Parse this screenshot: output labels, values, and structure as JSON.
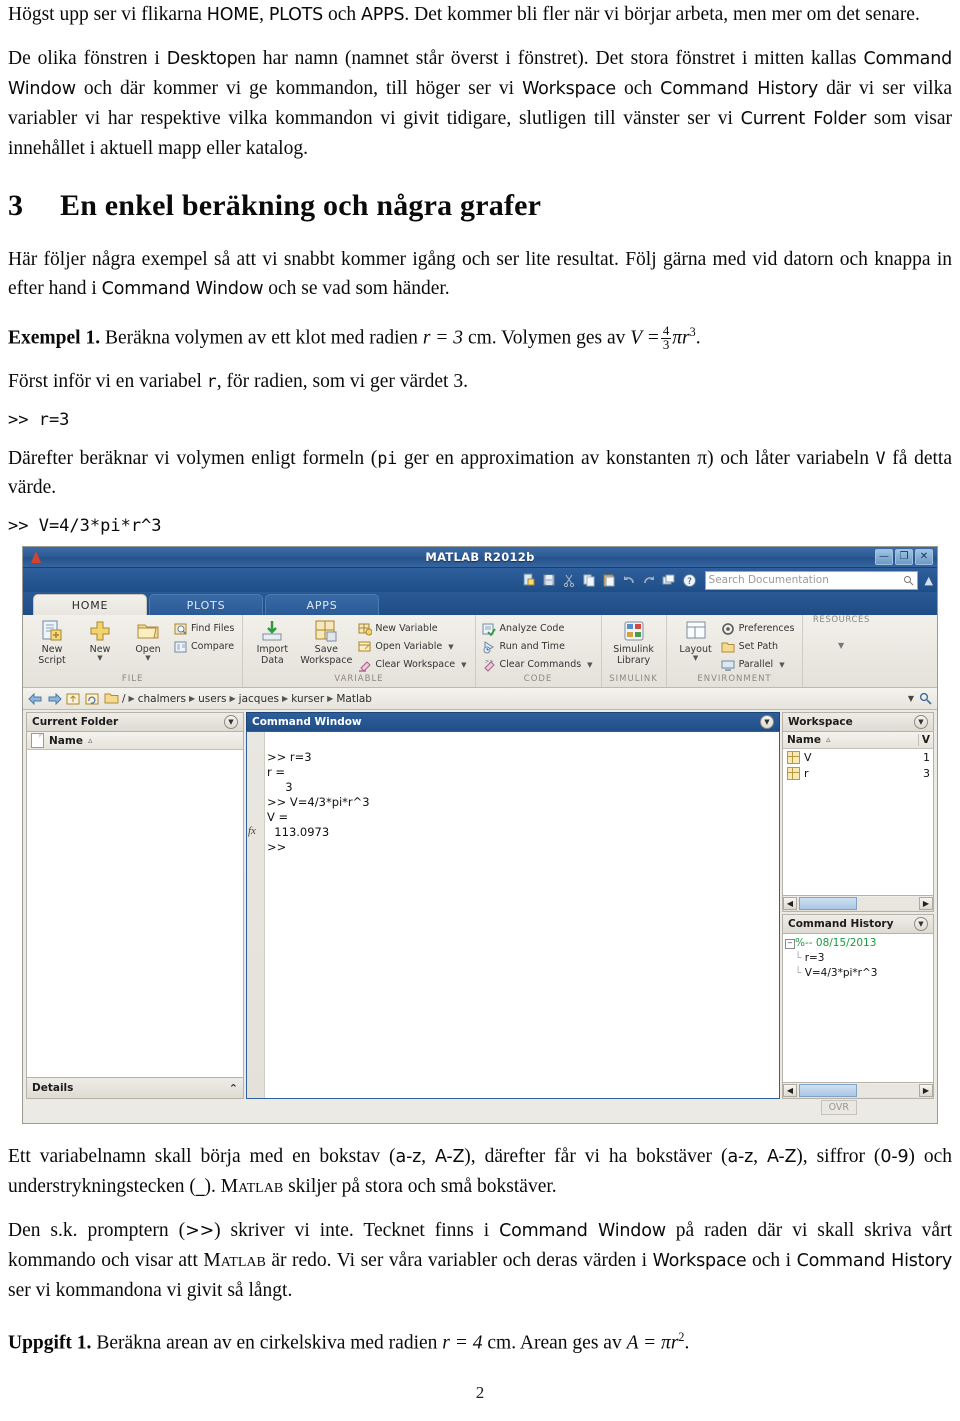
{
  "document": {
    "paragraphs": [
      {
        "id": "p1",
        "parts": [
          {
            "t": "text",
            "v": "Högst upp ser vi flikarna "
          },
          {
            "t": "ui",
            "v": "HOME"
          },
          {
            "t": "text",
            "v": ", "
          },
          {
            "t": "ui",
            "v": "PLOTS"
          },
          {
            "t": "text",
            "v": " och "
          },
          {
            "t": "ui",
            "v": "APPS"
          },
          {
            "t": "text",
            "v": ". Det kommer bli fler när vi börjar arbeta, men mer om det senare."
          }
        ]
      },
      {
        "id": "p2",
        "parts": [
          {
            "t": "text",
            "v": "De olika fönstren i "
          },
          {
            "t": "ui",
            "v": "Desktop"
          },
          {
            "t": "text",
            "v": "en har namn (namnet står överst i fönstret). Det stora fönstret i mitten kallas "
          },
          {
            "t": "ui",
            "v": "Command Window"
          },
          {
            "t": "text",
            "v": " och där kommer vi ge kommandon, till höger ser vi "
          },
          {
            "t": "ui",
            "v": "Workspace"
          },
          {
            "t": "text",
            "v": " och "
          },
          {
            "t": "ui",
            "v": "Command History"
          },
          {
            "t": "text",
            "v": " där vi ser vilka variabler vi har respektive vilka kommandon vi givit tidigare, slutligen till vänster ser vi "
          },
          {
            "t": "ui",
            "v": "Current Folder"
          },
          {
            "t": "text",
            "v": " som visar innehållet i aktuell mapp eller katalog."
          }
        ]
      }
    ],
    "section": {
      "number": "3",
      "title": "En enkel beräkning och några grafer"
    },
    "paragraphs2": [
      {
        "id": "p3",
        "parts": [
          {
            "t": "text",
            "v": "Här följer några exempel så att vi snabbt kommer igång och ser lite resultat. Följ gärna med vid datorn och knappa in efter hand i "
          },
          {
            "t": "ui",
            "v": "Command Window"
          },
          {
            "t": "text",
            "v": " och se vad som händer."
          }
        ]
      }
    ],
    "example1": {
      "label": "Exempel 1.",
      "text_before": " Beräkna volymen av ett klot med radien ",
      "radius_eq": "r = 3",
      "unit": " cm. Volymen ges av ",
      "formula_lhs": "V =",
      "frac_num": "4",
      "frac_den": "3",
      "formula_rhs": "πr",
      "formula_exp": "3",
      "period": "."
    },
    "paragraph_first_var": {
      "parts": [
        {
          "t": "text",
          "v": "Först inför vi en variabel "
        },
        {
          "t": "code",
          "v": "r"
        },
        {
          "t": "text",
          "v": ", för radien, som vi ger värdet 3."
        }
      ]
    },
    "cmd1": ">> r=3",
    "paragraph_volume": {
      "parts": [
        {
          "t": "text",
          "v": "Därefter beräknar vi volymen enligt formeln ("
        },
        {
          "t": "code",
          "v": "pi"
        },
        {
          "t": "text",
          "v": " ger en approximation av konstanten π) och låter variabeln "
        },
        {
          "t": "code",
          "v": "V"
        },
        {
          "t": "text",
          "v": " få detta värde."
        }
      ]
    },
    "cmd2": ">> V=4/3*pi*r^3",
    "paragraph_varname": {
      "parts": [
        {
          "t": "text",
          "v": "Ett variabelnamn skall börja med en bokstav ("
        },
        {
          "t": "ui",
          "v": "a-z"
        },
        {
          "t": "text",
          "v": ", "
        },
        {
          "t": "ui",
          "v": "A-Z"
        },
        {
          "t": "text",
          "v": "), därefter får vi ha bokstäver ("
        },
        {
          "t": "ui",
          "v": "a-z"
        },
        {
          "t": "text",
          "v": ", "
        },
        {
          "t": "ui",
          "v": "A-Z"
        },
        {
          "t": "text",
          "v": "), siffror ("
        },
        {
          "t": "ui",
          "v": "0-9"
        },
        {
          "t": "text",
          "v": ") och understrykningstecken ("
        },
        {
          "t": "ui",
          "v": "_"
        },
        {
          "t": "text",
          "v": "). "
        },
        {
          "t": "sc",
          "v": "Matlab"
        },
        {
          "t": "text",
          "v": " skiljer på stora och små bokstäver."
        }
      ]
    },
    "paragraph_prompt": {
      "parts": [
        {
          "t": "text",
          "v": "Den s.k. promptern ("
        },
        {
          "t": "ui",
          "v": ">>"
        },
        {
          "t": "text",
          "v": ") skriver vi inte. Tecknet finns i "
        },
        {
          "t": "ui",
          "v": "Command Window"
        },
        {
          "t": "text",
          "v": " på raden där vi skall skriva vårt kommando och visar att "
        },
        {
          "t": "sc",
          "v": "Matlab"
        },
        {
          "t": "text",
          "v": " är redo. Vi ser våra variabler och deras värden i "
        },
        {
          "t": "ui",
          "v": "Workspace"
        },
        {
          "t": "text",
          "v": " och i "
        },
        {
          "t": "ui",
          "v": "Command History"
        },
        {
          "t": "text",
          "v": " ser vi kommandona vi givit så långt."
        }
      ]
    },
    "task1": {
      "label": "Uppgift 1.",
      "text_before": " Beräkna arean av en cirkelskiva med radien ",
      "radius_eq": "r = 4",
      "unit": " cm. Arean ges av ",
      "formula_lhs": "A = πr",
      "formula_exp": "2",
      "period": "."
    },
    "page_number": "2"
  },
  "matlab": {
    "titlebar": {
      "title": "MATLAB R2012b",
      "minimize": "—",
      "maximize": "❐",
      "close": "✕"
    },
    "quick_access": {
      "icons": [
        "new-script-icon",
        "save-icon",
        "cut-icon",
        "copy-icon",
        "paste-icon",
        "undo-icon",
        "redo-icon",
        "switch-window-icon",
        "help-icon"
      ],
      "search_placeholder": "Search Documentation",
      "collapse_label": "▲"
    },
    "tabs": [
      {
        "label": "HOME",
        "active": true
      },
      {
        "label": "PLOTS",
        "active": false
      },
      {
        "label": "APPS",
        "active": false
      }
    ],
    "ribbon_groups": [
      {
        "name": "FILE",
        "big": [
          {
            "label": "New\nScript",
            "icon": "new-script-icon",
            "arrow": false
          },
          {
            "label": "New",
            "icon": "new-icon",
            "arrow": true
          },
          {
            "label": "Open",
            "icon": "open-folder-icon",
            "arrow": true
          }
        ],
        "small": [
          {
            "label": "Find Files",
            "icon": "find-files-icon",
            "arrow": false
          },
          {
            "label": "Compare",
            "icon": "compare-icon",
            "arrow": false
          }
        ]
      },
      {
        "name": "VARIABLE",
        "big": [
          {
            "label": "Import\nData",
            "icon": "import-data-icon",
            "arrow": false
          },
          {
            "label": "Save\nWorkspace",
            "icon": "save-workspace-icon",
            "arrow": false
          }
        ],
        "small": [
          {
            "label": "New Variable",
            "icon": "new-variable-icon",
            "arrow": false
          },
          {
            "label": "Open Variable",
            "icon": "open-variable-icon",
            "arrow": true
          },
          {
            "label": "Clear Workspace",
            "icon": "clear-workspace-icon",
            "arrow": true
          }
        ]
      },
      {
        "name": "CODE",
        "big": [],
        "small": [
          {
            "label": "Analyze Code",
            "icon": "analyze-code-icon",
            "arrow": false
          },
          {
            "label": "Run and Time",
            "icon": "run-and-time-icon",
            "arrow": false
          },
          {
            "label": "Clear Commands",
            "icon": "clear-commands-icon",
            "arrow": true
          }
        ]
      },
      {
        "name": "SIMULINK",
        "big": [
          {
            "label": "Simulink\nLibrary",
            "icon": "simulink-library-icon",
            "arrow": false
          }
        ],
        "small": []
      },
      {
        "name": "ENVIRONMENT",
        "big": [
          {
            "label": "Layout",
            "icon": "layout-icon",
            "arrow": true
          }
        ],
        "small": [
          {
            "label": "Preferences",
            "icon": "preferences-icon",
            "arrow": false
          },
          {
            "label": "Set Path",
            "icon": "set-path-icon",
            "arrow": false
          },
          {
            "label": "Parallel",
            "icon": "parallel-icon",
            "arrow": true
          }
        ]
      }
    ],
    "resources_label": "RESOURCES",
    "address_bar": {
      "back": "◀",
      "forward": "▶",
      "up": "⬆",
      "browse": "⟳",
      "root": "/",
      "crumbs": [
        "chalmers",
        "users",
        "jacques",
        "kurser",
        "Matlab"
      ],
      "search_icon": "search-icon"
    },
    "current_folder": {
      "title": "Current Folder",
      "column": "Name",
      "sort": "▵",
      "rows": [],
      "details_label": "Details"
    },
    "command_window": {
      "title": "Command Window",
      "lines": [
        ">> r=3",
        "r =",
        "     3",
        ">> V=4/3*pi*r^3",
        "V =",
        "  113.0973",
        ">>"
      ],
      "fx_label": "fx"
    },
    "workspace": {
      "title": "Workspace",
      "columns": [
        "Name",
        "V"
      ],
      "sort": "▵",
      "rows": [
        {
          "name": "V",
          "value": "1"
        },
        {
          "name": "r",
          "value": "3"
        }
      ]
    },
    "command_history": {
      "title": "Command History",
      "date": "%-- 08/15/2013",
      "entries": [
        "r=3",
        "V=4/3*pi*r^3"
      ]
    },
    "status": {
      "ovr": "OVR"
    }
  }
}
